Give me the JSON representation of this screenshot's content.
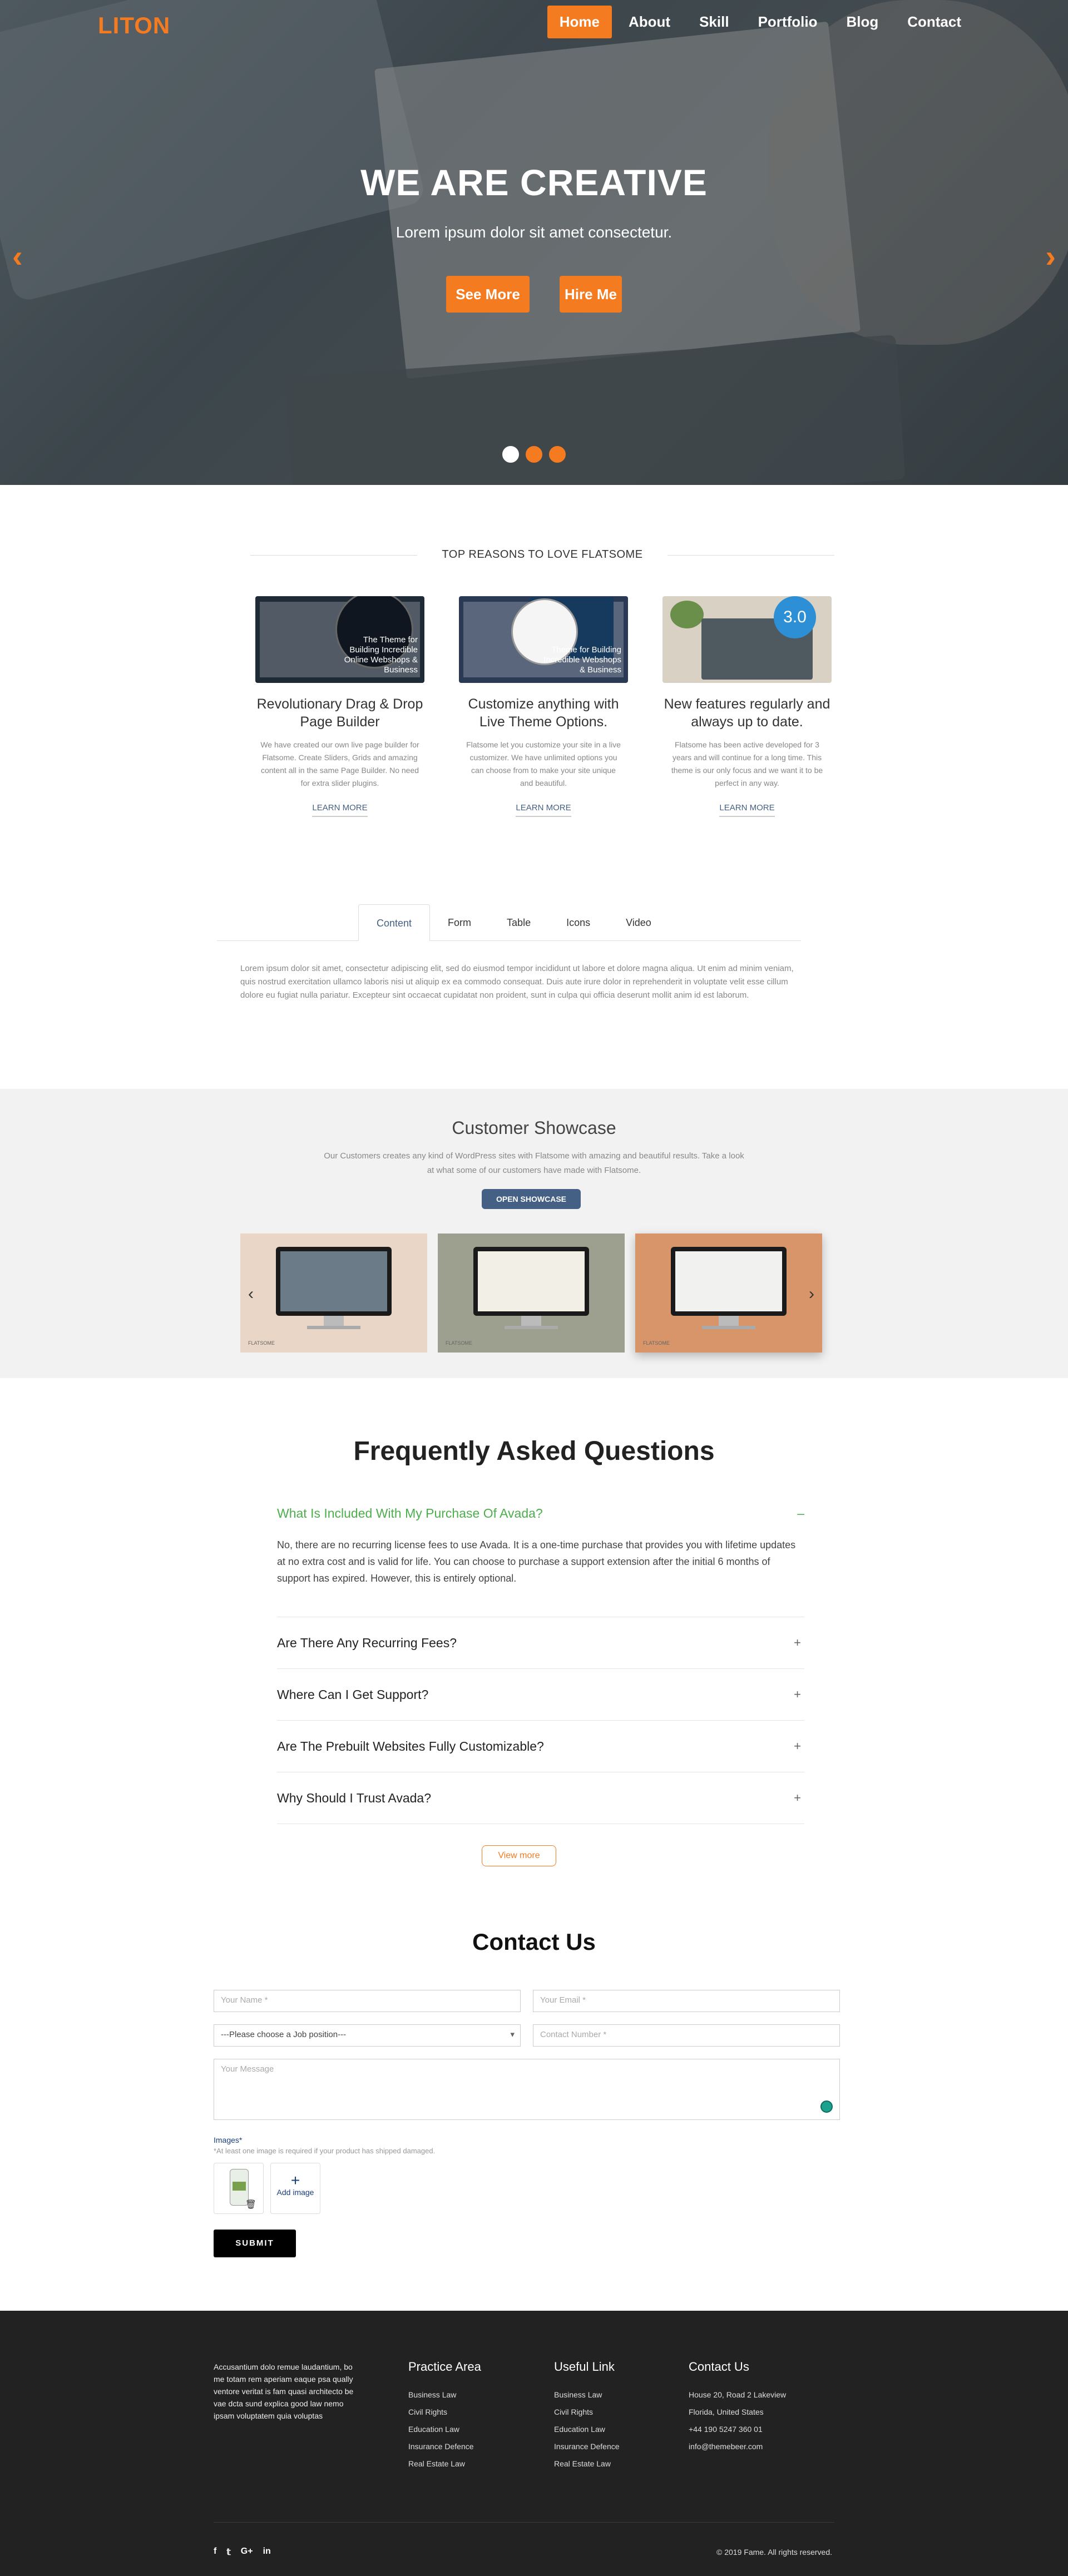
{
  "brand": {
    "logo": "LITON",
    "accent": "#f47b20"
  },
  "nav": [
    {
      "label": "Home",
      "active": true
    },
    {
      "label": "About"
    },
    {
      "label": "Skill"
    },
    {
      "label": "Portfolio"
    },
    {
      "label": "Blog"
    },
    {
      "label": "Contact"
    }
  ],
  "hero": {
    "title": "WE ARE CREATIVE",
    "subtitle": "Lorem ipsum dolor sit amet consectetur.",
    "buttons": [
      "See More",
      "Hire Me"
    ],
    "prev_icon": "chevron-left-icon",
    "next_icon": "chevron-right-icon",
    "slides": 3,
    "active_slide": 1
  },
  "reasons": {
    "title": "TOP REASONS TO LOVE FLATSOME",
    "items": [
      {
        "thumb_text": "The Theme for Building Incredible Online Webshops & Business",
        "heading": "Revolutionary Drag & Drop Page Builder",
        "text": "We have created our own live page builder for Flatsome. Create Sliders, Grids and amazing content all in the same Page Builder. No need for extra slider plugins.",
        "link": "LEARN MORE"
      },
      {
        "thumb_text": "Theme for Building Incredible Webshops & Business",
        "heading": "Customize anything with Live Theme Options.",
        "text": "Flatsome let you customize your site in a live customizer. We have unlimited options you can choose from to make your site unique and beautiful.",
        "link": "LEARN MORE"
      },
      {
        "thumb_text": "3.0",
        "heading": "New features regularly and always up to date.",
        "text": "Flatsome has been active developed for 3 years and will continue for a long time. This theme is our only focus and we want it to be perfect in any way.",
        "link": "LEARN MORE"
      }
    ]
  },
  "tabs": {
    "items": [
      "Content",
      "Form",
      "Table",
      "Icons",
      "Video"
    ],
    "active": "Content",
    "content": "Lorem ipsum dolor sit amet, consectetur adipiscing elit, sed do eiusmod tempor incididunt ut labore et dolore magna aliqua. Ut enim ad minim veniam, quis nostrud exercitation ullamco laboris nisi ut aliquip ex ea commodo consequat. Duis aute irure dolor in reprehenderit in voluptate velit esse cillum dolore eu fugiat nulla pariatur. Excepteur sint occaecat cupidatat non proident, sunt in culpa qui officia deserunt mollit anim id est laborum."
  },
  "showcase": {
    "title": "Customer Showcase",
    "text": "Our Customers creates any kind of WordPress sites with Flatsome with amazing and beautiful results. Take a look at what some of our customers have made with Flatsome.",
    "button": "OPEN SHOWCASE",
    "card_label": "FLATSOME"
  },
  "faq": {
    "title": "Frequently Asked Questions",
    "open": {
      "question": "What Is Included With My Purchase Of Avada?",
      "answer": "No, there are no recurring license fees to use Avada. It is a one-time purchase that provides you with lifetime updates at no extra cost and is valid for life. You can choose to purchase a support extension after the initial 6 months of support has expired. However, this is entirely optional.",
      "toggle": "–"
    },
    "items": [
      "Are There Any Recurring Fees?",
      "Where Can I Get Support?",
      "Are The Prebuilt Websites Fully Customizable?",
      "Why Should I Trust Avada?"
    ],
    "toggle_closed": "+",
    "view_more": "View more"
  },
  "contact": {
    "title": "Contact Us",
    "name_placeholder": "Your Name *",
    "email_placeholder": "Your Email *",
    "job_select": "---Please choose a Job position---",
    "number_placeholder": "Contact Number *",
    "message_placeholder": "Your Message",
    "images_label": "Images*",
    "images_note": "*At least one image is required if your product has shipped damaged.",
    "add_image": "Add image",
    "add_plus": "+",
    "submit": "SUBMIT"
  },
  "footer": {
    "about": "Accusantium dolo remue laudantium, bo me totam rem aperiam eaque psa qually ventore veritat is fam quasi architecto be vae dcta sund explica good law nemo ipsam voluptatem quia voluptas",
    "practice": {
      "title": "Practice Area",
      "links": [
        "Business Law",
        "Civil Rights",
        "Education Law",
        "Insurance Defence",
        "Real Estate Law"
      ]
    },
    "useful": {
      "title": "Useful Link",
      "links": [
        "Business Law",
        "Civil Rights",
        "Education Law",
        "Insurance Defence",
        "Real Estate Law"
      ]
    },
    "contact": {
      "title": "Contact Us",
      "lines": [
        "House 20, Road 2 Lakeview",
        "Florida, United States",
        "+44 190 5247 360 01",
        "info@themebeer.com"
      ]
    },
    "social": [
      "f",
      "𝕥",
      "G+",
      "in"
    ],
    "copyright": "© 2019 Fame. All rights reserved."
  }
}
